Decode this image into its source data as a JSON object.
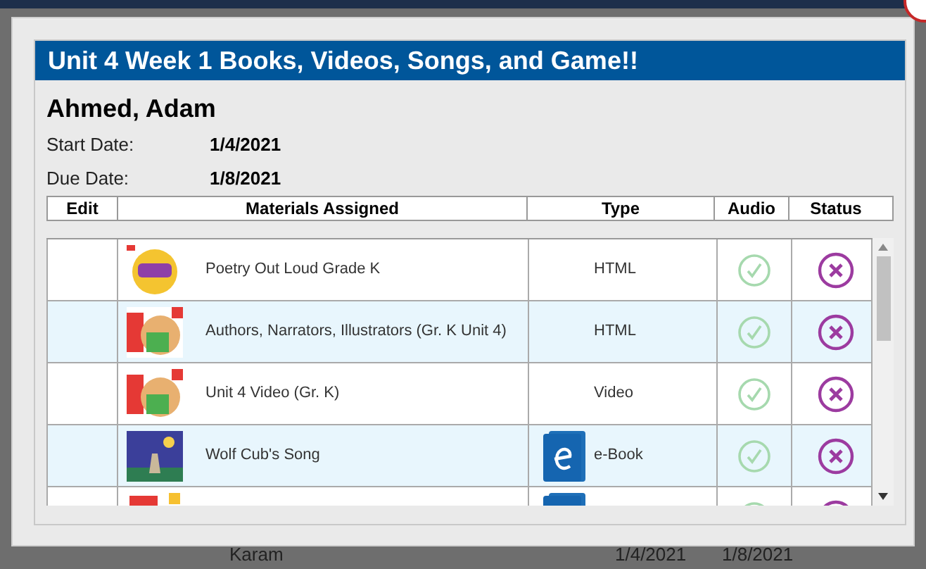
{
  "dialog": {
    "title": "Unit 4 Week 1 Books, Videos, Songs, and Game!!",
    "student": "Ahmed, Adam",
    "fields": [
      {
        "label": "Start Date:",
        "value": "1/4/2021"
      },
      {
        "label": "Due Date:",
        "value": "1/8/2021"
      }
    ],
    "table": {
      "columns": [
        "Edit",
        "Materials Assigned",
        "Type",
        "Audio",
        "Status"
      ],
      "rows": [
        {
          "kind": "web",
          "title": "Poetry Out Loud Grade K",
          "type": "HTML"
        },
        {
          "kind": "web",
          "title": "Authors, Narrators, Illustrators (Gr. K Unit 4)",
          "type": "HTML"
        },
        {
          "kind": "web",
          "title": "Unit 4 Video (Gr. K)",
          "type": "Video"
        },
        {
          "kind": "ebook",
          "title": "Wolf Cub's Song",
          "type": "e-Book"
        },
        {
          "kind": "ebook"
        }
      ]
    }
  },
  "background_row": {
    "name": "Karam",
    "start": "1/4/2021",
    "due": "1/8/2021"
  }
}
